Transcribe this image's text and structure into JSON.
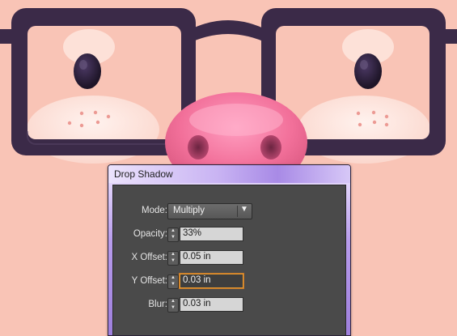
{
  "dialog": {
    "title": "Drop Shadow",
    "mode": {
      "label": "Mode:",
      "value": "Multiply",
      "arrow_icon": "triangle-down-icon"
    },
    "fields": [
      {
        "label": "Opacity:",
        "value": "33%",
        "focused": false
      },
      {
        "label": "X Offset:",
        "value": "0.05 in",
        "focused": false
      },
      {
        "label": "Y Offset:",
        "value": "0.03 in",
        "focused": true
      },
      {
        "label": "Blur:",
        "value": "0.03 in",
        "focused": false
      }
    ]
  },
  "colors": {
    "background": "#f9c4b6",
    "glasses": "#3b2a48",
    "snout": "#f27aa0",
    "panel": "#4a4a4a",
    "focus_ring": "#e79a2f"
  }
}
